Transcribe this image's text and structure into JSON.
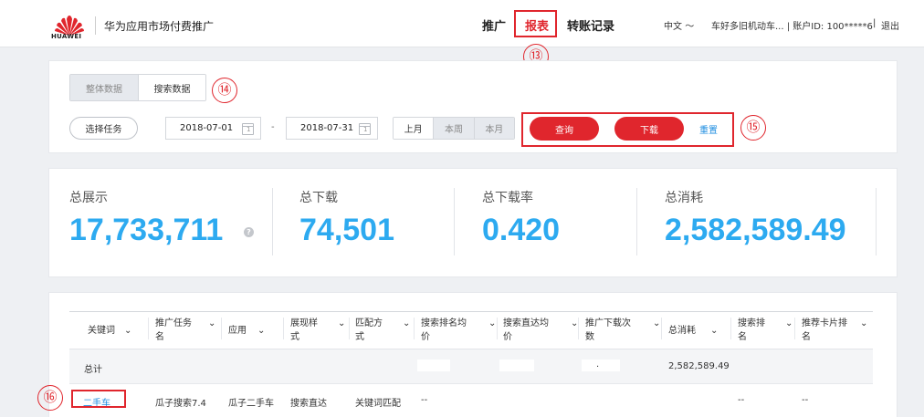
{
  "header": {
    "brand": "HUAWEI",
    "app_title": "华为应用市场付费推广",
    "nav": [
      {
        "label": "推广",
        "active": false
      },
      {
        "label": "报表",
        "active": true
      },
      {
        "label": "转账记录",
        "active": false
      }
    ],
    "language": "中文",
    "language_chevron": "〜",
    "account": "车好多旧机动车... | 账户ID: 100*****6",
    "separator": "|",
    "logout": "退出"
  },
  "annotations": {
    "a13": "⑬",
    "a14": "⑭",
    "a15": "⑮",
    "a16": "⑯"
  },
  "filters": {
    "data_tabs": [
      {
        "label": "整体数据",
        "selected": true
      },
      {
        "label": "搜索数据",
        "selected": false
      }
    ],
    "select_task": "选择任务",
    "start_date": "2018-07-01",
    "end_date": "2018-07-31",
    "date_sep": "-",
    "periods": [
      {
        "label": "上月",
        "selected": false
      },
      {
        "label": "本周",
        "selected": true
      },
      {
        "label": "本月",
        "selected": true
      }
    ],
    "query": "查询",
    "download": "下载",
    "reset": "重置"
  },
  "stats": [
    {
      "label": "总展示",
      "value": "17,733,711"
    },
    {
      "label": "总下载",
      "value": "74,501"
    },
    {
      "label": "总下载率",
      "value": "0.420"
    },
    {
      "label": "总消耗",
      "value": "2,582,589.49"
    }
  ],
  "help_icon": "?",
  "table": {
    "columns": [
      {
        "line1": "关键词",
        "line2": ""
      },
      {
        "line1": "推广任务",
        "line2": "名"
      },
      {
        "line1": "应用",
        "line2": ""
      },
      {
        "line1": "展现样",
        "line2": "式"
      },
      {
        "line1": "匹配方",
        "line2": "式"
      },
      {
        "line1": "搜索排名均",
        "line2": "价"
      },
      {
        "line1": "搜索直达均",
        "line2": "价"
      },
      {
        "line1": "推广下载次",
        "line2": "数"
      },
      {
        "line1": "总消耗",
        "line2": ""
      },
      {
        "line1": "搜索排",
        "line2": "名"
      },
      {
        "line1": "推荐卡片排",
        "line2": "名"
      }
    ],
    "chevron": "⌄",
    "total_row": {
      "label": "总计",
      "dot": ".",
      "total_cost": "2,582,589.49"
    },
    "rows": [
      {
        "keyword": "二手车",
        "task": "瓜子搜索7.4",
        "app": "瓜子二手车",
        "style": "搜索直达",
        "match": "关键词匹配",
        "rank_price": "--",
        "rank": "--",
        "card_rank": "--"
      }
    ]
  }
}
